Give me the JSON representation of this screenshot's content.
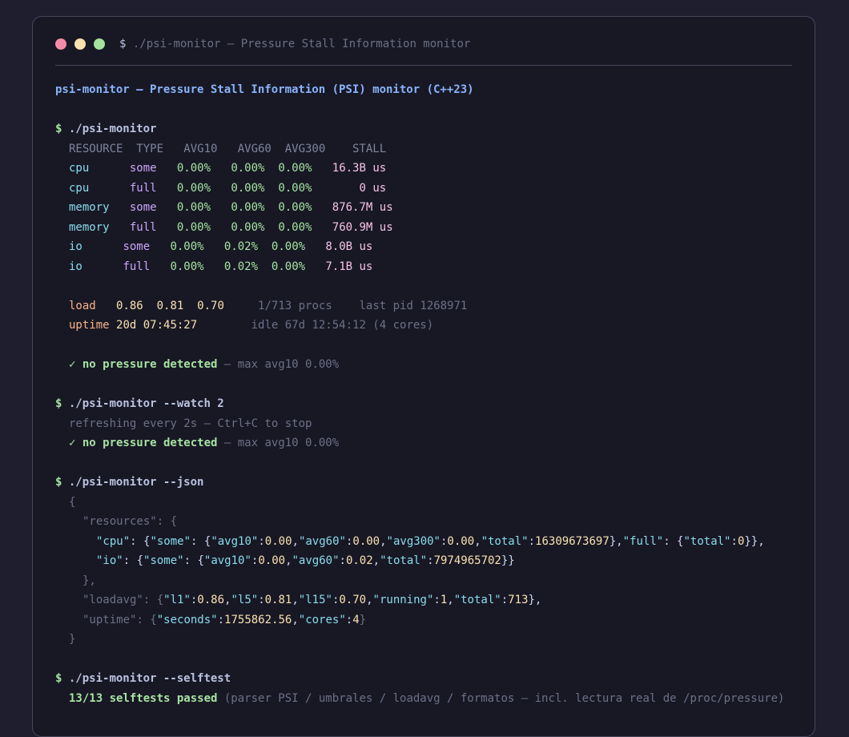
{
  "window": {
    "prompt": "$",
    "title": "./psi-monitor — Pressure Stall Information monitor"
  },
  "header_line": "psi-monitor — Pressure Stall Information (PSI) monitor (C++23)",
  "session": {
    "cmd1": {
      "prompt": "$",
      "command": "./psi-monitor"
    },
    "table_header": "RESOURCE  TYPE   AVG10   AVG60  AVG300    STALL",
    "rows": [
      {
        "resource": "cpu      ",
        "type": "some   ",
        "avg10": "0.00%   ",
        "avg60": "0.00%  ",
        "avg300": "0.00%   ",
        "stall": "16.3B us"
      },
      {
        "resource": "cpu      ",
        "type": "full   ",
        "avg10": "0.00%   ",
        "avg60": "0.00%  ",
        "avg300": "0.00%       ",
        "stall": "0 us"
      },
      {
        "resource": "memory   ",
        "type": "some   ",
        "avg10": "0.00%   ",
        "avg60": "0.00%  ",
        "avg300": "0.00%   ",
        "stall": "876.7M us"
      },
      {
        "resource": "memory   ",
        "type": "full   ",
        "avg10": "0.00%   ",
        "avg60": "0.00%  ",
        "avg300": "0.00%   ",
        "stall": "760.9M us"
      },
      {
        "resource": "io      ",
        "type": "some   ",
        "avg10": "0.00%   ",
        "avg60": "0.02%  ",
        "avg300": "0.00%   ",
        "stall": "8.0B us"
      },
      {
        "resource": "io      ",
        "type": "full   ",
        "avg10": "0.00%   ",
        "avg60": "0.02%  ",
        "avg300": "0.00%   ",
        "stall": "7.1B us"
      }
    ],
    "load": {
      "label": "load   ",
      "values": "0.86  0.81  0.70     ",
      "procs": "1/713 procs    last pid 1268971"
    },
    "uptime": {
      "label": "uptime ",
      "value": "20d 07:45:27        ",
      "idle": "idle 67d 12:54:12 (4 cores)"
    },
    "status1": {
      "check": "✓ ",
      "text": "no pressure detected",
      "detail": " — max avg10 0.00%"
    },
    "cmd2": {
      "prompt": "$",
      "command": "./psi-monitor --watch 2"
    },
    "refresh_note": "refreshing every 2s — Ctrl+C to stop",
    "status2": {
      "check": "✓ ",
      "text": "no pressure detected",
      "detail": " — max avg10 0.00%"
    },
    "cmd3": {
      "prompt": "$",
      "command": "./psi-monitor --json"
    },
    "json": {
      "open_brace": "{",
      "resources_open": "\"resources\": {",
      "cpu_line": [
        {
          "t": "\"cpu\"",
          "c": "cyan"
        },
        {
          "t": ": {",
          "c": "white"
        },
        {
          "t": "\"some\"",
          "c": "cyan"
        },
        {
          "t": ": {",
          "c": "white"
        },
        {
          "t": "\"avg10\"",
          "c": "cyan"
        },
        {
          "t": ":",
          "c": "white"
        },
        {
          "t": "0.00",
          "c": "num"
        },
        {
          "t": ",",
          "c": "white"
        },
        {
          "t": "\"avg60\"",
          "c": "cyan"
        },
        {
          "t": ":",
          "c": "white"
        },
        {
          "t": "0.00",
          "c": "num"
        },
        {
          "t": ",",
          "c": "white"
        },
        {
          "t": "\"avg300\"",
          "c": "cyan"
        },
        {
          "t": ":",
          "c": "white"
        },
        {
          "t": "0.00",
          "c": "num"
        },
        {
          "t": ",",
          "c": "white"
        },
        {
          "t": "\"total\"",
          "c": "cyan"
        },
        {
          "t": ":",
          "c": "white"
        },
        {
          "t": "16309673697",
          "c": "num"
        },
        {
          "t": "},",
          "c": "white"
        },
        {
          "t": "\"full\"",
          "c": "cyan"
        },
        {
          "t": ": {",
          "c": "white"
        },
        {
          "t": "\"total\"",
          "c": "cyan"
        },
        {
          "t": ":",
          "c": "white"
        },
        {
          "t": "0",
          "c": "num"
        },
        {
          "t": "}},",
          "c": "white"
        }
      ],
      "io_line": [
        {
          "t": "\"io\"",
          "c": "cyan"
        },
        {
          "t": ": {",
          "c": "white"
        },
        {
          "t": "\"some\"",
          "c": "cyan"
        },
        {
          "t": ": {",
          "c": "white"
        },
        {
          "t": "\"avg10\"",
          "c": "cyan"
        },
        {
          "t": ":",
          "c": "white"
        },
        {
          "t": "0.00",
          "c": "num"
        },
        {
          "t": ",",
          "c": "white"
        },
        {
          "t": "\"avg60\"",
          "c": "cyan"
        },
        {
          "t": ":",
          "c": "white"
        },
        {
          "t": "0.02",
          "c": "num"
        },
        {
          "t": ",",
          "c": "white"
        },
        {
          "t": "\"total\"",
          "c": "cyan"
        },
        {
          "t": ":",
          "c": "white"
        },
        {
          "t": "7974965702",
          "c": "num"
        },
        {
          "t": "}}",
          "c": "white"
        }
      ],
      "resources_close": "},",
      "loadavg_line": [
        {
          "t": "\"loadavg\"",
          "c": "gray"
        },
        {
          "t": ": {",
          "c": "gray"
        },
        {
          "t": "\"l1\"",
          "c": "cyan"
        },
        {
          "t": ":",
          "c": "white"
        },
        {
          "t": "0.86",
          "c": "num"
        },
        {
          "t": ",",
          "c": "white"
        },
        {
          "t": "\"l5\"",
          "c": "cyan"
        },
        {
          "t": ":",
          "c": "white"
        },
        {
          "t": "0.81",
          "c": "num"
        },
        {
          "t": ",",
          "c": "white"
        },
        {
          "t": "\"l15\"",
          "c": "cyan"
        },
        {
          "t": ":",
          "c": "white"
        },
        {
          "t": "0.70",
          "c": "num"
        },
        {
          "t": ",",
          "c": "white"
        },
        {
          "t": "\"running\"",
          "c": "cyan"
        },
        {
          "t": ":",
          "c": "white"
        },
        {
          "t": "1",
          "c": "num"
        },
        {
          "t": ",",
          "c": "white"
        },
        {
          "t": "\"total\"",
          "c": "cyan"
        },
        {
          "t": ":",
          "c": "white"
        },
        {
          "t": "713",
          "c": "num"
        },
        {
          "t": "},",
          "c": "white"
        }
      ],
      "uptime_line": [
        {
          "t": "\"uptime\"",
          "c": "gray"
        },
        {
          "t": ": {",
          "c": "gray"
        },
        {
          "t": "\"seconds\"",
          "c": "cyan"
        },
        {
          "t": ":",
          "c": "white"
        },
        {
          "t": "1755862.56",
          "c": "num"
        },
        {
          "t": ",",
          "c": "white"
        },
        {
          "t": "\"cores\"",
          "c": "cyan"
        },
        {
          "t": ":",
          "c": "white"
        },
        {
          "t": "4",
          "c": "num"
        },
        {
          "t": "}",
          "c": "gray"
        }
      ],
      "close_brace": "}"
    },
    "cmd4": {
      "prompt": "$",
      "command": "./psi-monitor --selftest"
    },
    "selftest": {
      "result": "13/13 selftests passed",
      "detail": " (parser PSI / umbrales / loadavg / formatos — incl. lectura real de /proc/pressure)"
    }
  },
  "colors": {
    "background": "#1e1e2e",
    "panel": "#181825",
    "accent_blue": "#89b4fa",
    "green": "#a6e3a1",
    "cyan": "#89dceb",
    "mauve": "#cba6f7",
    "pink": "#f5c2e7",
    "peach": "#fab387",
    "yellow": "#f9e2af",
    "muted": "#6c7086"
  }
}
